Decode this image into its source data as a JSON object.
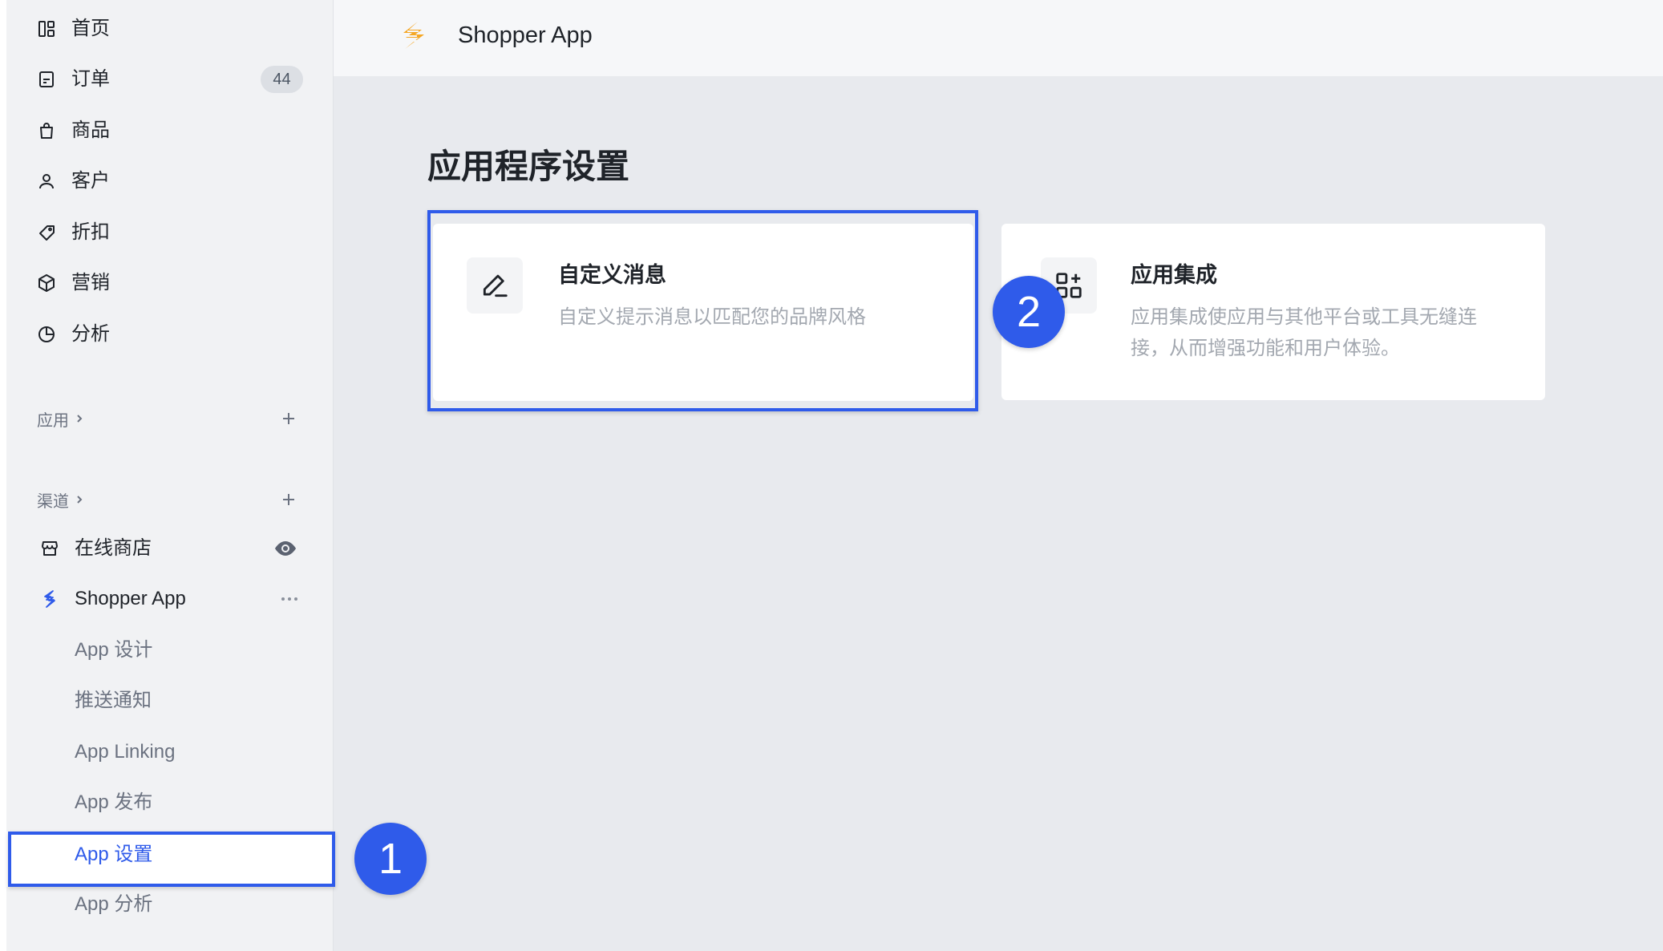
{
  "header": {
    "app_name": "Shopper App",
    "logo_icon": "shopper-logo-icon"
  },
  "sidebar": {
    "nav": [
      {
        "label": "首页",
        "icon": "dashboard-icon"
      },
      {
        "label": "订单",
        "icon": "order-icon",
        "badge": "44"
      },
      {
        "label": "商品",
        "icon": "bag-icon"
      },
      {
        "label": "客户",
        "icon": "user-icon"
      },
      {
        "label": "折扣",
        "icon": "tag-icon"
      },
      {
        "label": "营销",
        "icon": "cube-icon"
      },
      {
        "label": "分析",
        "icon": "pie-chart-icon"
      }
    ],
    "apps_section": {
      "label": "应用"
    },
    "channels_section": {
      "label": "渠道"
    },
    "channels": [
      {
        "label": "在线商店",
        "icon": "store-icon",
        "action_icon": "eye-icon"
      },
      {
        "label": "Shopper App",
        "icon": "shopper-logo-icon",
        "action_icon": "ellipsis-icon"
      }
    ],
    "subitems": [
      {
        "label": "App 设计"
      },
      {
        "label": "推送通知"
      },
      {
        "label": "App Linking"
      },
      {
        "label": "App 发布"
      },
      {
        "label": "App 设置",
        "active": true
      },
      {
        "label": "App 分析"
      }
    ]
  },
  "main": {
    "title": "应用程序设置",
    "cards": [
      {
        "title": "自定义消息",
        "description_lines": [
          "自定义提示消息以匹配您的品牌风格"
        ],
        "icon": "edit-icon"
      },
      {
        "title": "应用集成",
        "description_lines": [
          "应用集成使应用与其他平台或工具无缝连",
          "接，从而增强功能和用户体验。"
        ],
        "icon": "apps-add-icon"
      }
    ]
  },
  "annotations": [
    {
      "label": "1"
    },
    {
      "label": "2"
    }
  ],
  "colors": {
    "accent": "#2f5bea",
    "logo": "#f5a623",
    "sidebar_bg": "#f1f2f4",
    "main_bg": "#e8eaee"
  }
}
